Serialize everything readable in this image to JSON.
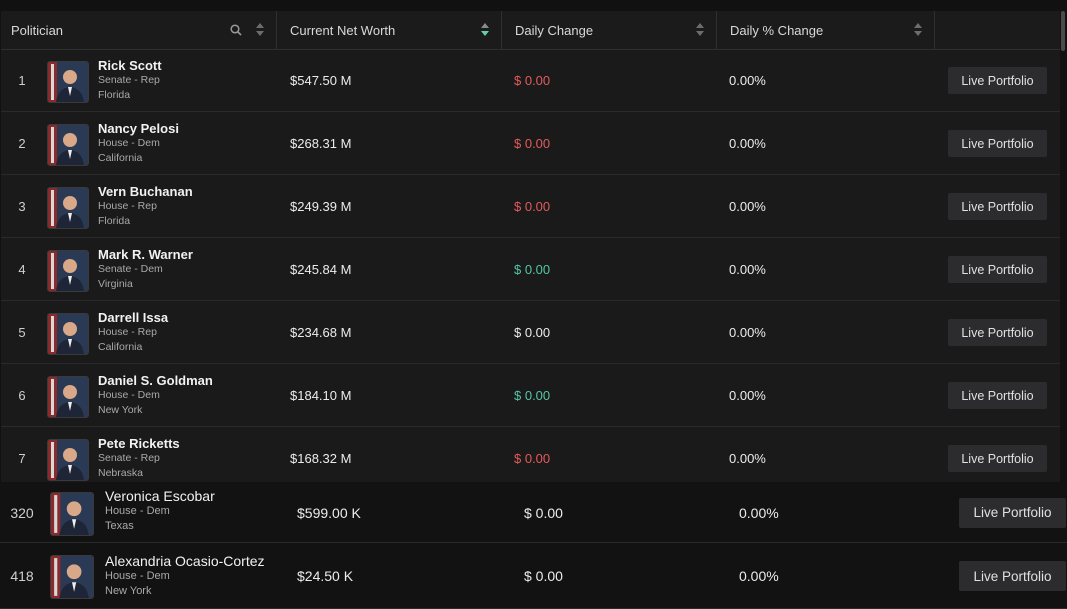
{
  "header": {
    "politician": "Politician",
    "net_worth": "Current Net Worth",
    "daily_change": "Daily Change",
    "daily_pct": "Daily % Change"
  },
  "button_label": "Live Portfolio",
  "colors": {
    "negative": "#e35b5b",
    "positive": "#54c6a4"
  },
  "rows": [
    {
      "rank": "1",
      "name": "Rick Scott",
      "chamber": "Senate - Rep",
      "state": "Florida",
      "net_worth": "$547.50 M",
      "daily_change": "$ 0.00",
      "change_color": "red",
      "daily_pct": "0.00%"
    },
    {
      "rank": "2",
      "name": "Nancy Pelosi",
      "chamber": "House - Dem",
      "state": "California",
      "net_worth": "$268.31 M",
      "daily_change": "$ 0.00",
      "change_color": "red",
      "daily_pct": "0.00%"
    },
    {
      "rank": "3",
      "name": "Vern Buchanan",
      "chamber": "House - Rep",
      "state": "Florida",
      "net_worth": "$249.39 M",
      "daily_change": "$ 0.00",
      "change_color": "red",
      "daily_pct": "0.00%"
    },
    {
      "rank": "4",
      "name": "Mark R. Warner",
      "chamber": "Senate - Dem",
      "state": "Virginia",
      "net_worth": "$245.84 M",
      "daily_change": "$ 0.00",
      "change_color": "green",
      "daily_pct": "0.00%"
    },
    {
      "rank": "5",
      "name": "Darrell Issa",
      "chamber": "House - Rep",
      "state": "California",
      "net_worth": "$234.68 M",
      "daily_change": "$ 0.00",
      "change_color": "neutral",
      "daily_pct": "0.00%"
    },
    {
      "rank": "6",
      "name": "Daniel S. Goldman",
      "chamber": "House - Dem",
      "state": "New York",
      "net_worth": "$184.10 M",
      "daily_change": "$ 0.00",
      "change_color": "green",
      "daily_pct": "0.00%"
    },
    {
      "rank": "7",
      "name": "Pete Ricketts",
      "chamber": "Senate - Rep",
      "state": "Nebraska",
      "net_worth": "$168.32 M",
      "daily_change": "$ 0.00",
      "change_color": "red",
      "daily_pct": "0.00%"
    }
  ],
  "bottom_rows": [
    {
      "rank": "320",
      "name": "Veronica Escobar",
      "chamber": "House - Dem",
      "state": "Texas",
      "net_worth": "$599.00 K",
      "daily_change": "$ 0.00",
      "change_color": "neutral",
      "daily_pct": "0.00%"
    },
    {
      "rank": "418",
      "name": "Alexandria Ocasio-Cortez",
      "chamber": "House - Dem",
      "state": "New York",
      "net_worth": "$24.50 K",
      "daily_change": "$ 0.00",
      "change_color": "neutral",
      "daily_pct": "0.00%"
    }
  ]
}
